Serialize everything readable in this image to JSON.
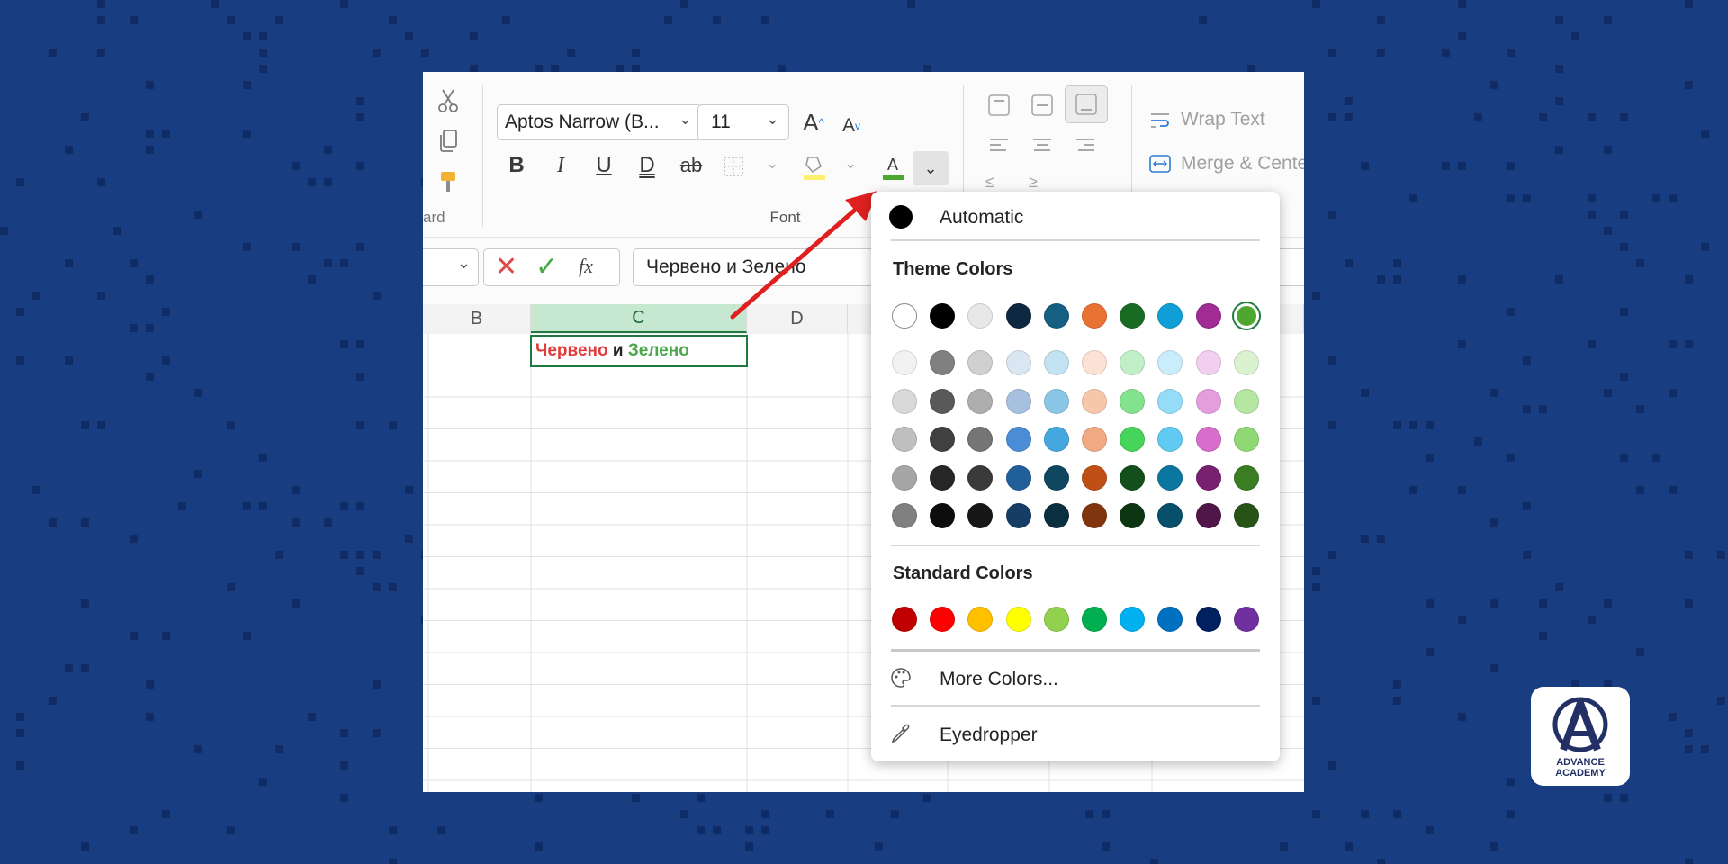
{
  "colors": {
    "background": "#183d80",
    "arrow": "#e02020",
    "selected_header": "#c6e8d1",
    "cell_border": "#1e7a3e",
    "red_text": "#e03b3b",
    "green_text": "#4aa84a"
  },
  "ribbon": {
    "clipboard_label": "ard",
    "font_group_label": "Font",
    "font_name": "Aptos Narrow (B...",
    "font_size": "11",
    "wrap_text": "Wrap Text",
    "merge_center": "Merge & Cente",
    "icons": [
      "cut-icon",
      "copy-icon",
      "format-painter-icon",
      "bold-icon",
      "italic-icon",
      "underline-icon",
      "double-underline-icon",
      "strikethrough-icon",
      "borders-icon",
      "fill-color-icon",
      "font-color-icon",
      "increase-font-icon",
      "decrease-font-icon"
    ]
  },
  "formula_bar": {
    "value": "Червено и Зелено",
    "fx": "fx"
  },
  "sheet": {
    "columns": [
      "B",
      "C",
      "D"
    ],
    "cell_c1": {
      "part1": "Червено",
      "part2": "и",
      "part3": "Зелено"
    }
  },
  "color_menu": {
    "automatic_label": "Automatic",
    "theme_colors_label": "Theme Colors",
    "standard_colors_label": "Standard Colors",
    "more_colors_label": "More Colors...",
    "eyedropper_label": "Eyedropper",
    "theme_top_row": [
      "#ffffff",
      "#000000",
      "#e8e8e8",
      "#0e2841",
      "#156082",
      "#e97132",
      "#196b24",
      "#0f9ed5",
      "#a02b93",
      "#4ea72e"
    ],
    "theme_shades": [
      [
        "#f2f2f2",
        "#808080",
        "#d0d0d0",
        "#dbe6f3",
        "#c3e2f2",
        "#fbe2d5",
        "#c1f0c8",
        "#caedfb",
        "#f2cfee",
        "#dbf2d0"
      ],
      [
        "#d9d9d9",
        "#595959",
        "#aeaeae",
        "#a7c0e0",
        "#8ac6e6",
        "#f7c7ac",
        "#83e28e",
        "#95dcf8",
        "#e59edd",
        "#b5e6a2"
      ],
      [
        "#bfbfbf",
        "#404040",
        "#757575",
        "#4a8cd6",
        "#44a8df",
        "#f1a983",
        "#47d45a",
        "#60caf3",
        "#d86dcb",
        "#8ed973"
      ],
      [
        "#a6a6a6",
        "#262626",
        "#3a3a3a",
        "#215f9a",
        "#0f4761",
        "#c04f15",
        "#124f1a",
        "#0b76a0",
        "#782170",
        "#3b7d23"
      ],
      [
        "#808080",
        "#0d0d0d",
        "#171717",
        "#163e64",
        "#0a2f41",
        "#80350e",
        "#0c3511",
        "#074f6a",
        "#501549",
        "#275317"
      ]
    ],
    "standard": [
      "#c00000",
      "#ff0000",
      "#ffc000",
      "#ffff00",
      "#92d050",
      "#00b050",
      "#00b0f0",
      "#0070c0",
      "#002060",
      "#7030a0"
    ],
    "selected_theme_index": 9
  },
  "logo": {
    "line1": "ADVANCE",
    "line2": "ACADEMY",
    "letter": "A"
  }
}
